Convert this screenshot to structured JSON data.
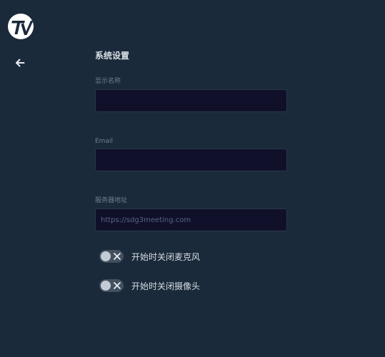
{
  "header": {
    "logo_icon": "tv-logo-icon",
    "back_icon": "arrow-left-icon"
  },
  "settings": {
    "title": "系统设置",
    "fields": [
      {
        "label": "显示名称",
        "value": "",
        "placeholder": ""
      },
      {
        "label": "Email",
        "value": "",
        "placeholder": ""
      },
      {
        "label": "服务器地址",
        "value": "",
        "placeholder": "https://sdg3meeting.com"
      }
    ],
    "toggles": [
      {
        "label": "开始时关闭麦克风",
        "checked": false,
        "icon": "close-icon"
      },
      {
        "label": "开始时关闭摄像头",
        "checked": false,
        "icon": "close-icon"
      }
    ]
  },
  "colors": {
    "background": "#1a2a3a",
    "input_background": "#11102a",
    "text": "#d7dde3",
    "muted_text": "#6f7f8f",
    "toggle_track": "#42505f",
    "toggle_knob": "#c3ccd6"
  }
}
